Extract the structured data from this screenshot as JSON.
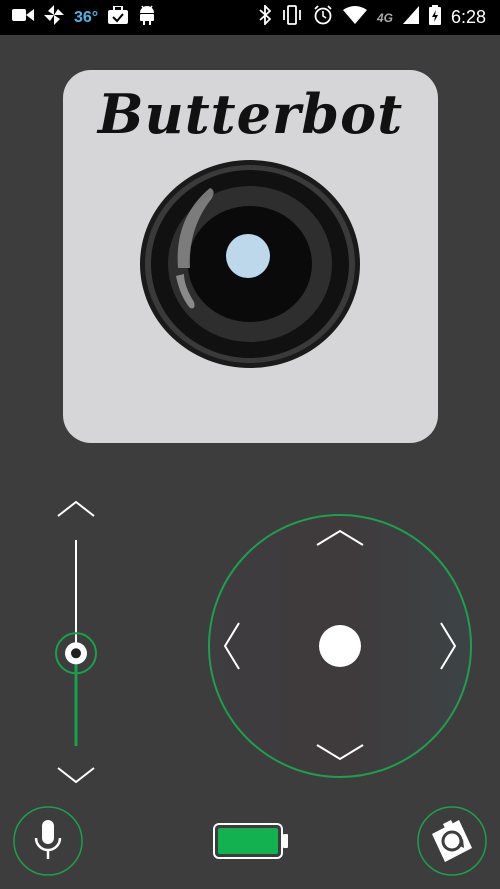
{
  "status_bar": {
    "temperature": "36°",
    "network": "4G",
    "time": "6:28",
    "icons_left": [
      "video-camera-icon",
      "pinwheel-icon",
      "temperature-text",
      "briefcase-check-icon",
      "android-icon"
    ],
    "icons_right": [
      "bluetooth-icon",
      "vibrate-icon",
      "alarm-icon",
      "wifi-icon",
      "signal-icon",
      "battery-charging-icon"
    ]
  },
  "logo": {
    "title": "Butterbot",
    "camera_icon": "camera-lens-icon"
  },
  "controls": {
    "slider": {
      "up_icon": "chevron-up-icon",
      "down_icon": "chevron-down-icon",
      "level": 0.45,
      "accent": "#19a04a"
    },
    "joystick": {
      "up_icon": "chevron-up-icon",
      "down_icon": "chevron-down-icon",
      "left_icon": "chevron-left-icon",
      "right_icon": "chevron-right-icon",
      "ring_color": "#1e9e4f"
    }
  },
  "bottom_bar": {
    "mic_icon": "microphone-icon",
    "battery_icon": "battery-icon",
    "battery_level": 1.0,
    "battery_color": "#14b150",
    "reset_icon": "camera-rotate-icon"
  }
}
